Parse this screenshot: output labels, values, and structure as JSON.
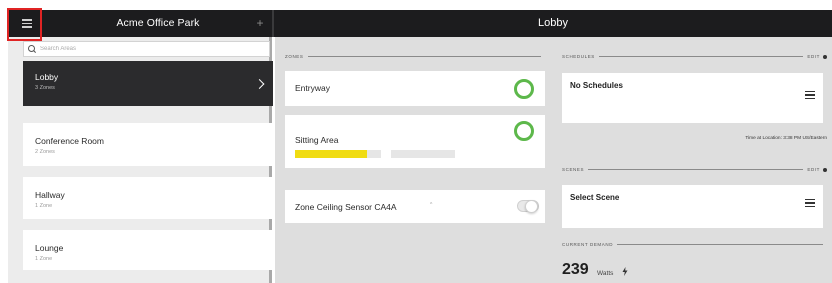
{
  "header": {
    "site_name": "Acme Office Park",
    "add_symbol": "+",
    "page_title": "Lobby"
  },
  "sidebar": {
    "search": {
      "placeholder": "Search Areas",
      "value": ""
    },
    "items": [
      {
        "label": "Lobby",
        "sub": "3 Zones",
        "active": true
      },
      {
        "label": "Conference Room",
        "sub": "2 Zones",
        "active": false
      },
      {
        "label": "Hallway",
        "sub": "1 Zone",
        "active": false
      },
      {
        "label": "Lounge",
        "sub": "1 Zone",
        "active": false
      }
    ]
  },
  "zones": {
    "header": "Zones",
    "items": [
      {
        "label": "Entryway",
        "control": "ring",
        "on": true
      },
      {
        "label": "Sitting Area",
        "control": "ring",
        "on": true,
        "level": 0.45
      },
      {
        "label": "Zone Ceiling Sensor CA4A",
        "caret": "^",
        "control": "toggle",
        "on": false
      }
    ]
  },
  "schedules": {
    "header": "Schedules",
    "edit_label": "Edit",
    "card_title": "No Schedules",
    "time_note": "Time at Location: 3:38 PM US/Eastern"
  },
  "scenes": {
    "header": "Scenes",
    "edit_label": "Edit",
    "card_title": "Select Scene"
  },
  "demand": {
    "header": "Current Demand",
    "value": "239",
    "unit": "Watts",
    "icon": "bolt-icon"
  },
  "colors": {
    "header_bg": "#1c1c1e",
    "accent_green": "#5db84b",
    "level_yellow": "#f0dc12",
    "highlight_red": "#e02424"
  }
}
